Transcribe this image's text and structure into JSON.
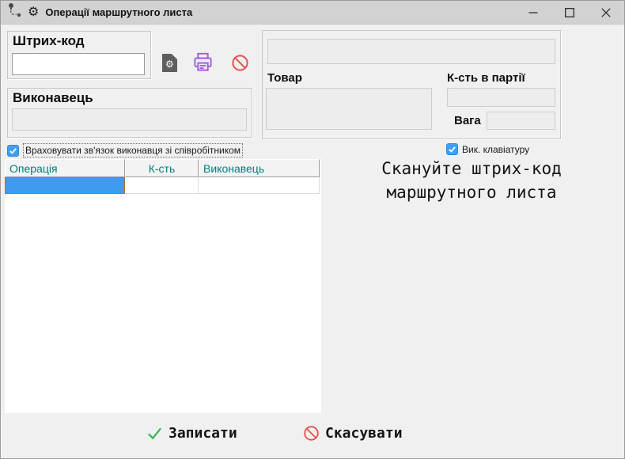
{
  "window": {
    "title": "Операції маршрутного листа"
  },
  "barcode": {
    "label": "Штрих-код",
    "value": ""
  },
  "executor": {
    "label": "Виконавець",
    "value": ""
  },
  "details": {
    "scan_value": "",
    "product_label": "Товар",
    "product_value": "",
    "batch_label": "К-сть в партії",
    "batch_value": "",
    "weight_label": "Вага",
    "weight_value": ""
  },
  "options": {
    "link_executor_label": "Враховувати зв'язок виконавця зі співробітником",
    "link_executor_checked": true,
    "use_keyboard_label": "Вик. клавіатуру",
    "use_keyboard_checked": true
  },
  "grid": {
    "columns": [
      {
        "label": "Операція"
      },
      {
        "label": "К-сть"
      },
      {
        "label": "Виконавець"
      }
    ],
    "rows": [
      {
        "operation": "",
        "qty": "",
        "executor": "",
        "selected": true
      }
    ]
  },
  "hint": {
    "line1": "Скануйте штрих-код",
    "line2": "маршрутного листа"
  },
  "actions": {
    "save": "Записати",
    "cancel": "Скасувати"
  },
  "icons": {
    "titlebar": [
      "route-icon",
      "gear-icon"
    ],
    "barcode_tools": [
      "document-gear-icon",
      "print-icon",
      "ban-icon"
    ],
    "window_controls": [
      "minimize-icon",
      "maximize-icon",
      "close-icon"
    ],
    "action_icons": [
      "check-icon",
      "ban-icon"
    ]
  },
  "colors": {
    "titlebar_bg": "#d2d2d2",
    "body_bg": "#f0f0f0",
    "selection_blue": "#3e9bf0",
    "selection_border": "#b9712a",
    "grid_header_text": "#007d7d",
    "checkbox_blue": "#3f9ef7",
    "print_purple": "#a25ddc",
    "ban_red": "#e8504f",
    "check_green": "#34bb52"
  }
}
